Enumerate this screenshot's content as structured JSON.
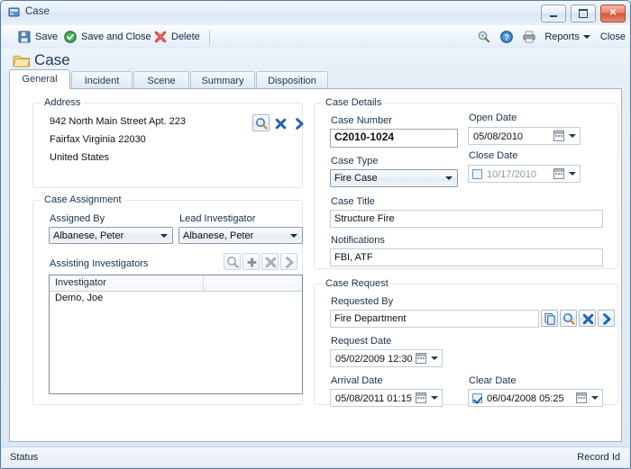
{
  "window": {
    "title": "Case",
    "icon": "app-window-icon",
    "buttons": {
      "minimize": "Minimize",
      "maximize": "Maximize",
      "close": "Close"
    }
  },
  "toolbar": {
    "save_label": "Save",
    "save_close_label": "Save and Close",
    "delete_label": "Delete",
    "reports_label": "Reports",
    "close_label": "Close",
    "icons": [
      "save-icon",
      "save-and-close-icon",
      "delete-icon",
      "audit-icon",
      "help-icon",
      "print-icon"
    ]
  },
  "page": {
    "title": "Case",
    "icon": "folder-icon"
  },
  "tabs": [
    {
      "label": "General",
      "active": true
    },
    {
      "label": "Incident",
      "active": false
    },
    {
      "label": "Scene",
      "active": false
    },
    {
      "label": "Summary",
      "active": false
    },
    {
      "label": "Disposition",
      "active": false
    }
  ],
  "address": {
    "group_label": "Address",
    "lines": [
      "942 North Main Street Apt. 223",
      "Fairfax Virginia 22030",
      "United States"
    ],
    "actions": [
      "search-icon",
      "clear-icon",
      "go-icon"
    ]
  },
  "case_assignment": {
    "group_label": "Case Assignment",
    "assigned_by_label": "Assigned By",
    "assigned_by_value": "Albanese, Peter",
    "lead_investigator_label": "Lead Investigator",
    "lead_investigator_value": "Albanese, Peter",
    "assisting_label": "Assisting Investigators",
    "actions": [
      "search-icon",
      "add-icon",
      "remove-icon",
      "go-icon"
    ],
    "grid": {
      "columns": [
        "Investigator",
        ""
      ],
      "rows": [
        [
          "Demo, Joe",
          ""
        ]
      ]
    }
  },
  "case_details": {
    "group_label": "Case Details",
    "case_number_label": "Case Number",
    "case_number_value": "C2010-1024",
    "open_date_label": "Open Date",
    "open_date_value": "05/08/2010",
    "case_type_label": "Case Type",
    "case_type_value": "Fire Case",
    "close_date_label": "Close Date",
    "close_date_value": "10/17/2010",
    "close_date_checked": false,
    "case_title_label": "Case Title",
    "case_title_value": "Structure Fire",
    "notifications_label": "Notifications",
    "notifications_value": "FBI, ATF"
  },
  "case_request": {
    "group_label": "Case Request",
    "requested_by_label": "Requested By",
    "requested_by_value": "Fire Department",
    "actions": [
      "copy-icon",
      "search-icon",
      "clear-icon",
      "go-icon"
    ],
    "request_date_label": "Request Date",
    "request_date_value": "05/02/2009 12:30",
    "arrival_date_label": "Arrival Date",
    "arrival_date_value": "05/08/2011 01:15",
    "clear_date_label": "Clear Date",
    "clear_date_value": "06/04/2008 05:25",
    "clear_date_checked": true
  },
  "statusbar": {
    "left": "Status",
    "right": "Record Id"
  },
  "colors": {
    "accent_blue": "#1b63a8",
    "window_border": "#5a7ca3",
    "close_red": "#d4553a",
    "folder_yellow": "#f2c75c",
    "label_text": "#18304a"
  }
}
